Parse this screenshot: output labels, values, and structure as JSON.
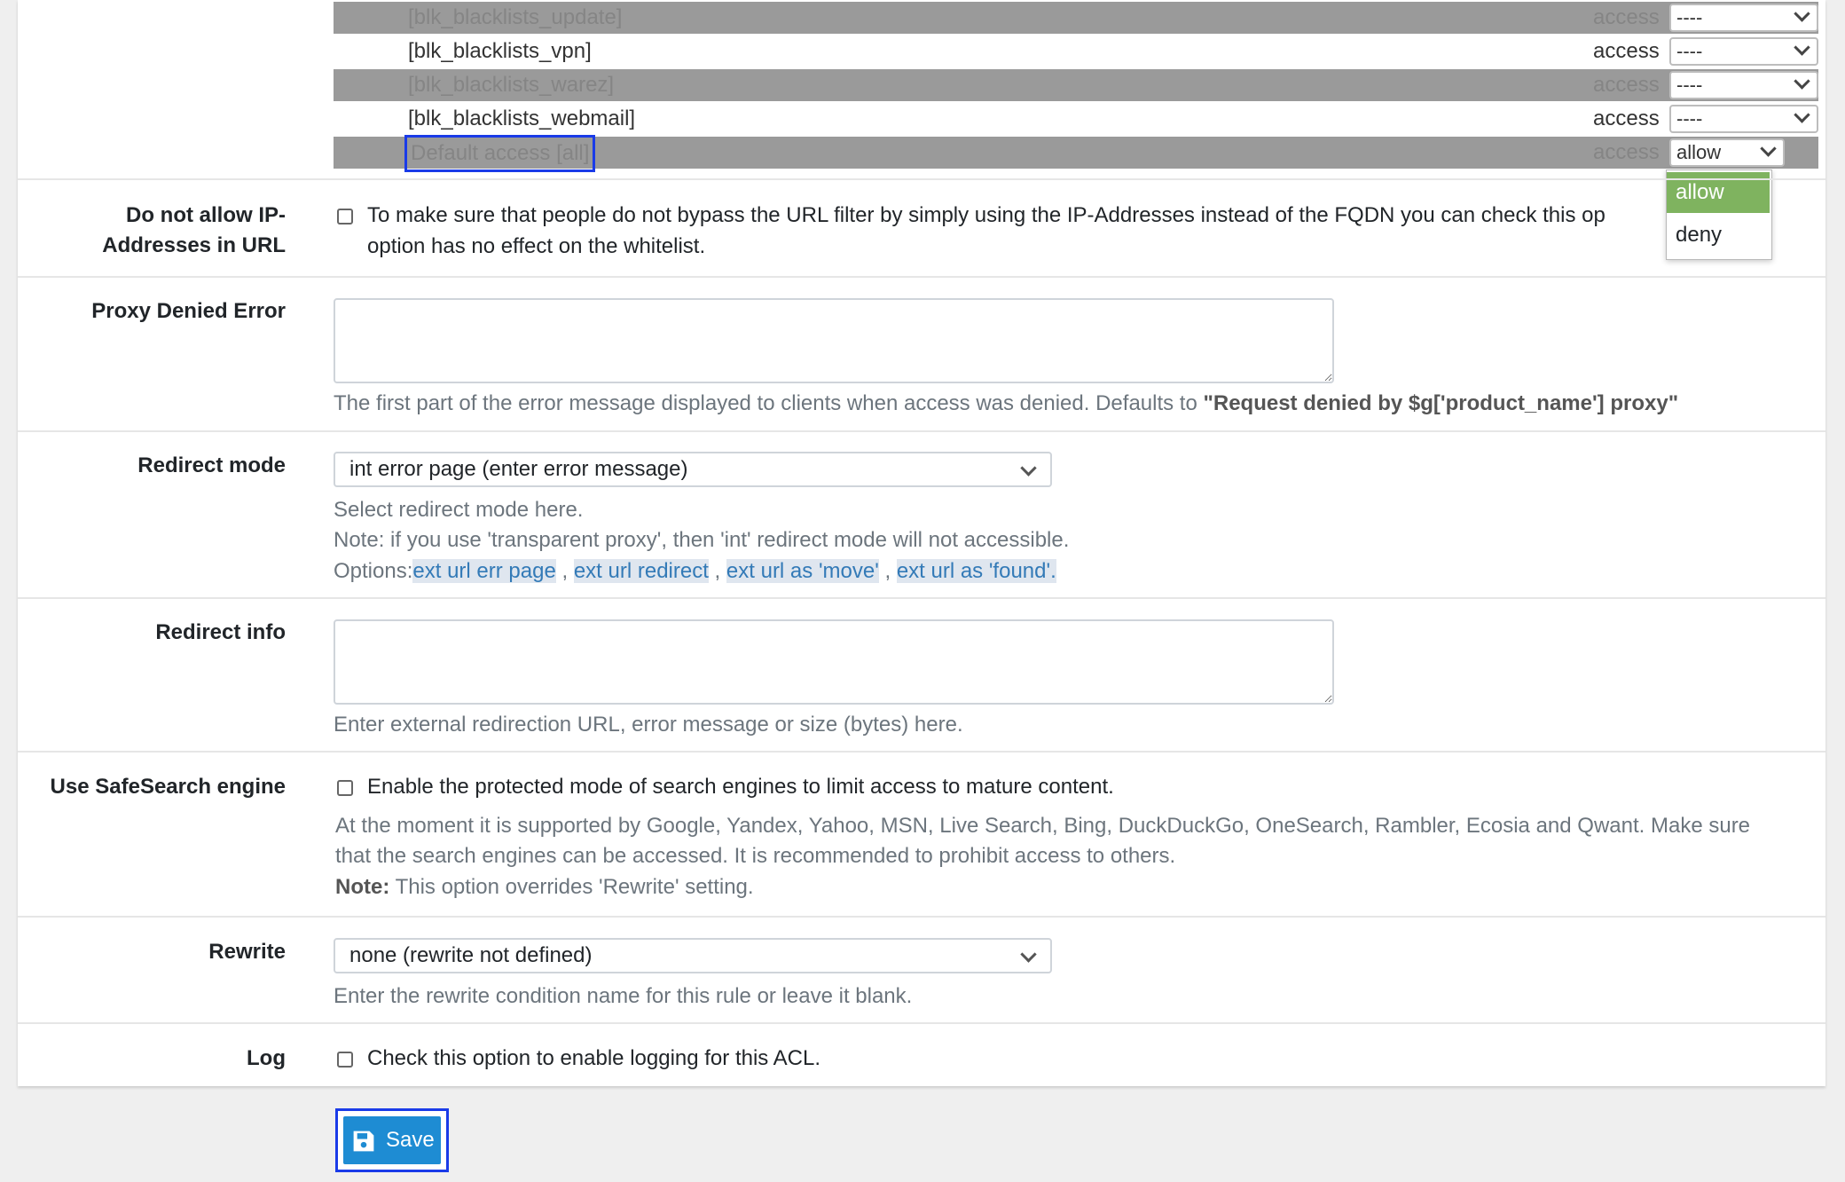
{
  "acl_rows": [
    {
      "name": "[blk_blacklists_update]",
      "access_label": "access",
      "value": "----"
    },
    {
      "name": "[blk_blacklists_vpn]",
      "access_label": "access",
      "value": "----"
    },
    {
      "name": "[blk_blacklists_warez]",
      "access_label": "access",
      "value": "----"
    },
    {
      "name": "[blk_blacklists_webmail]",
      "access_label": "access",
      "value": "----"
    },
    {
      "name": "Default access [all]",
      "access_label": "access",
      "value": "allow"
    }
  ],
  "access_dropdown": {
    "options": [
      "allow",
      "deny"
    ],
    "selected": "allow"
  },
  "ip_addresses": {
    "label_line1": "Do not allow IP-",
    "label_line2": "Addresses in URL",
    "text_line1": "To make sure that people do not bypass the URL filter by simply using the IP-Addresses instead of the FQDN you can check this op",
    "text_line2": "option has no effect on the whitelist."
  },
  "proxy_denied": {
    "label": "Proxy Denied Error",
    "value": "",
    "help_prefix": "The first part of the error message displayed to clients when access was denied. Defaults to ",
    "help_bold": "\"Request denied by $g['product_name'] proxy\""
  },
  "redirect_mode": {
    "label": "Redirect mode",
    "value": "int error page (enter error message)",
    "help1": "Select redirect mode here.",
    "help2": "Note: if you use 'transparent proxy', then 'int' redirect mode will not accessible.",
    "options_prefix": "Options:",
    "options": [
      "ext url err page",
      "ext url redirect",
      "ext url as 'move'",
      "ext url as 'found'."
    ],
    "separator": " , "
  },
  "redirect_info": {
    "label": "Redirect info",
    "value": "",
    "help": "Enter external redirection URL, error message or size (bytes) here."
  },
  "safesearch": {
    "label": "Use SafeSearch engine",
    "checkbox_text": "Enable the protected mode of search engines to limit access to mature content.",
    "help1": "At the moment it is supported by Google, Yandex, Yahoo, MSN, Live Search, Bing, DuckDuckGo, OneSearch, Rambler, Ecosia and Qwant. Make sure",
    "help2": "that the search engines can be accessed. It is recommended to prohibit access to others.",
    "note_bold": "Note:",
    "note_text": " This option overrides 'Rewrite' setting."
  },
  "rewrite": {
    "label": "Rewrite",
    "value": "none (rewrite not defined)",
    "help": "Enter the rewrite condition name for this rule or leave it blank."
  },
  "log": {
    "label": "Log",
    "checkbox_text": "Check this option to enable logging for this ACL."
  },
  "save_button": {
    "label": "Save",
    "icon": "floppy-disk-icon"
  },
  "colors": {
    "accent": "#1e8cd3",
    "link": "#337ab7",
    "dropdown_selected": "#7fb35f",
    "focus_border": "#1a3be8"
  }
}
